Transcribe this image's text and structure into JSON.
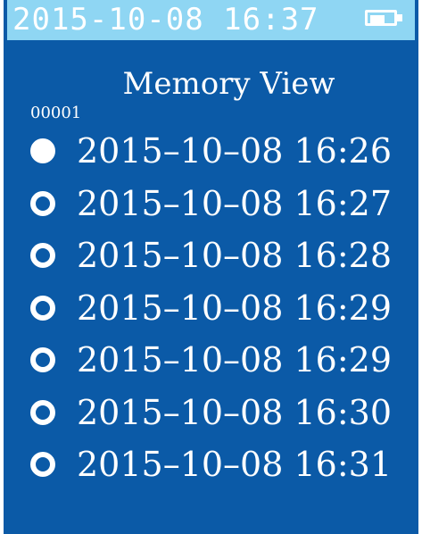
{
  "status": {
    "datetime": "2015-10-08  16:37",
    "battery_level": 0.65
  },
  "screen": {
    "title": "Memory View",
    "record_id": "00001"
  },
  "entries": [
    {
      "text": "2015–10–08 16:26",
      "selected": true
    },
    {
      "text": "2015–10–08 16:27",
      "selected": false
    },
    {
      "text": "2015–10–08 16:28",
      "selected": false
    },
    {
      "text": "2015–10–08 16:29",
      "selected": false
    },
    {
      "text": "2015–10–08 16:29",
      "selected": false
    },
    {
      "text": "2015–10–08 16:30",
      "selected": false
    },
    {
      "text": "2015–10–08 16:31",
      "selected": false
    }
  ],
  "colors": {
    "background": "#0b5aa7",
    "status_bar": "#8fd6f3",
    "foreground": "#ffffff"
  }
}
